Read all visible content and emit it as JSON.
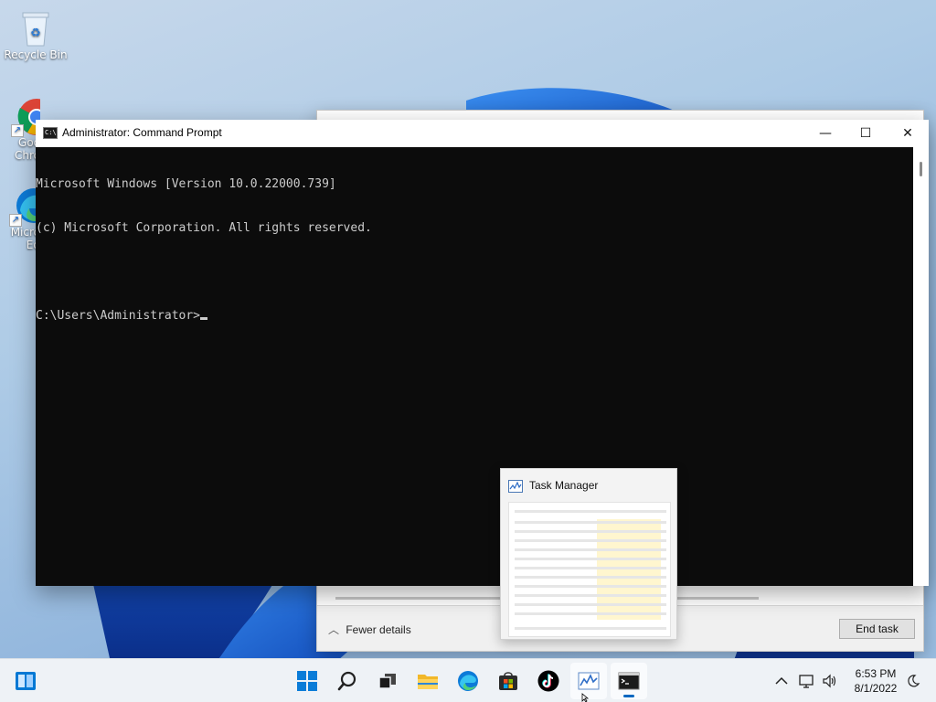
{
  "desktop": {
    "icons": [
      {
        "label": "Recycle Bin",
        "icon": "recycle-bin-icon"
      },
      {
        "label": "Goo Chro",
        "icon": "chrome-icon"
      },
      {
        "label": "Micro Ed",
        "icon": "edge-icon"
      }
    ]
  },
  "cmd": {
    "title": "Administrator: Command Prompt",
    "lines": [
      "Microsoft Windows [Version 10.0.22000.739]",
      "(c) Microsoft Corporation. All rights reserved.",
      "",
      "C:\\Users\\Administrator>"
    ],
    "controls": {
      "minimize": "—",
      "maximize": "☐",
      "close": "✕"
    }
  },
  "task_manager": {
    "fewer_details": "Fewer details",
    "end_task": "End task"
  },
  "preview": {
    "title": "Task Manager"
  },
  "taskbar": {
    "left_widget": "widgets-icon",
    "pinned": [
      {
        "name": "start-icon"
      },
      {
        "name": "search-icon"
      },
      {
        "name": "task-view-icon"
      },
      {
        "name": "file-explorer-icon"
      },
      {
        "name": "edge-icon"
      },
      {
        "name": "store-icon"
      },
      {
        "name": "tiktok-icon"
      },
      {
        "name": "task-manager-icon"
      },
      {
        "name": "command-prompt-icon"
      }
    ],
    "tray": {
      "time": "6:53 PM",
      "date": "8/1/2022"
    },
    "accent": "#0067c0"
  }
}
